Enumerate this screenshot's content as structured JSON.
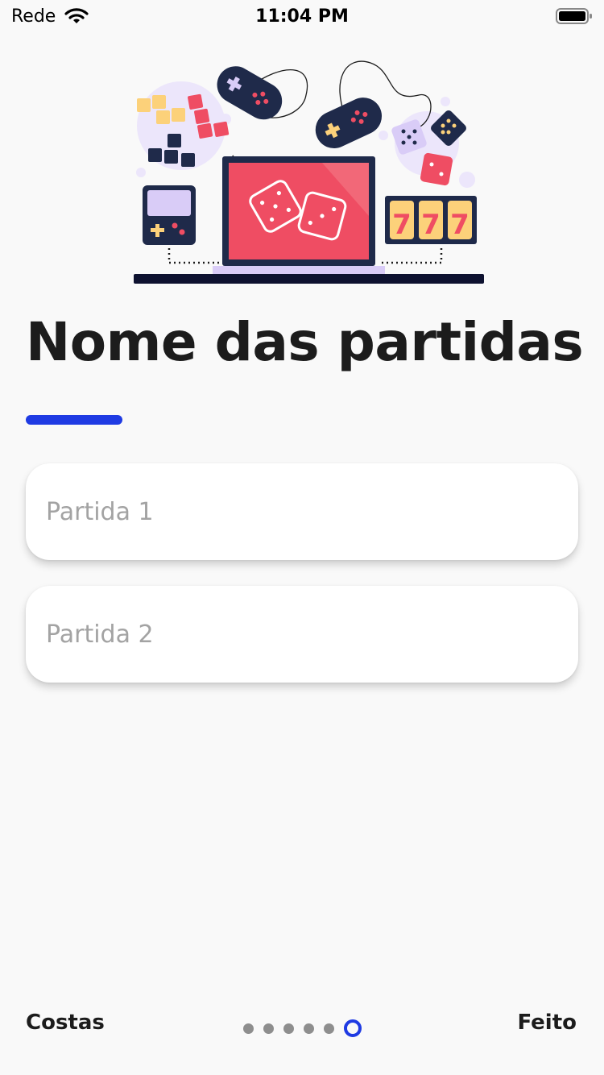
{
  "status_bar": {
    "carrier": "Rede",
    "time": "11:04 PM"
  },
  "illustration": {
    "slot_reels": [
      "7",
      "7",
      "7"
    ],
    "icons": [
      "gamepad-icon",
      "gamepad-icon",
      "dice-icon",
      "slot-machine-icon",
      "handheld-console-icon",
      "laptop-icon",
      "tetris-blocks-icon"
    ]
  },
  "page": {
    "title": "Nome das partidas"
  },
  "fields": [
    {
      "placeholder": "Partida 1",
      "value": ""
    },
    {
      "placeholder": "Partida 2",
      "value": ""
    }
  ],
  "footer": {
    "back_label": "Costas",
    "done_label": "Feito",
    "page_count": 6,
    "current_page": 6
  },
  "colors": {
    "accent": "#1f3be3",
    "background": "#f9f9f9",
    "title": "#1c1c1c",
    "placeholder": "#a3a3a3",
    "illustration_red": "#ef4d63",
    "illustration_navy": "#1f2a4a",
    "illustration_yellow": "#fcd17a",
    "illustration_lavender": "#d9ccf7"
  }
}
